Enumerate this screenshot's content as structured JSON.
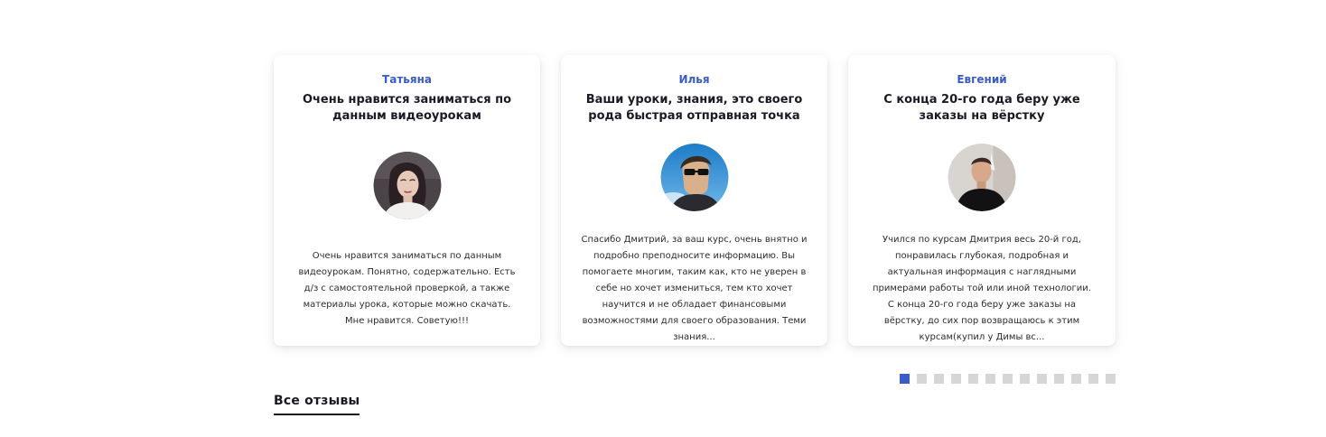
{
  "reviews": [
    {
      "author": "Татьяна",
      "title": "Очень нравится заниматься по данным видеоурокам",
      "avatar": "woman-portrait-avatar",
      "text": "Очень нравится заниматься по данным видеоурокам. Понятно, содержательно. Есть д/з с самостоятельной проверкой, а также материалы урока, которые можно скачать. Мне нравится. Советую!!!"
    },
    {
      "author": "Илья",
      "title": "Ваши уроки, знания, это своего рода быстрая отправная точка",
      "avatar": "man-sunglasses-avatar",
      "text": "Спасибо Дмитрий, за ваш курс, очень внятно и подробно преподносите информацию. Вы помогаете многим, таким как, кто не уверен в себе но хочет измениться, тем кто хочет научится и не обладает финансовыми возможностями для своего образования. Теми знания..."
    },
    {
      "author": "Евгений",
      "title": "С конца 20-го года беру уже заказы на вёрстку",
      "avatar": "man-portrait-avatar",
      "text": "Учился по курсам Дмитрия весь 20-й год, понравилась глубокая, подробная и актуальная информация с наглядными примерами работы той или иной технологии. С конца 20-го года беру уже заказы на вёрстку, до сих пор возвращаюсь к этим курсам(купил у Димы вс..."
    }
  ],
  "pager": {
    "total": 13,
    "active_index": 0
  },
  "all_reviews_link": "Все отзывы",
  "colors": {
    "accent": "#3a5bc7",
    "inactive_dot": "#d6d6d6",
    "text": "#1a1a24"
  }
}
